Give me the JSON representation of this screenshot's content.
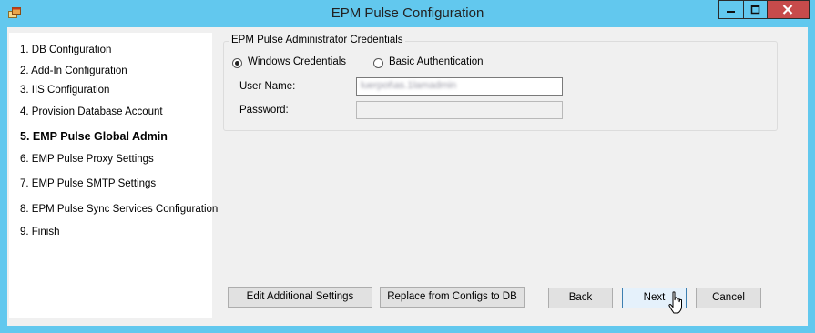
{
  "window": {
    "title": "EPM Pulse Configuration",
    "controls": {
      "minimize": "minimize",
      "maximize": "maximize",
      "close": "close"
    }
  },
  "steps": [
    {
      "label": "1. DB Configuration",
      "current": false
    },
    {
      "label": "2. Add-In Configuration",
      "current": false
    },
    {
      "label": "3. IIS Configuration",
      "current": false
    },
    {
      "label": "4. Provision Database Account",
      "current": false
    },
    {
      "label": "5. EMP Pulse Global Admin",
      "current": true
    },
    {
      "label": "6. EMP Pulse Proxy Settings",
      "current": false
    },
    {
      "label": "7. EMP Pulse SMTP Settings",
      "current": false
    },
    {
      "label": "8. EPM Pulse Sync Services Configuration",
      "current": false
    },
    {
      "label": "9. Finish",
      "current": false
    }
  ],
  "credentials": {
    "group_title": "EPM Pulse Administrator Credentials",
    "auth_options": [
      {
        "label": "Windows Credentials",
        "selected": true
      },
      {
        "label": "Basic Authentication",
        "selected": false
      }
    ],
    "username_label": "User Name:",
    "username_value": "luerpot\\as.1lamadmin",
    "password_label": "Password:",
    "password_value": ""
  },
  "buttons": {
    "edit_settings": "Edit Additional Settings",
    "replace_configs": "Replace from Configs to DB",
    "back": "Back",
    "next": "Next",
    "cancel": "Cancel"
  },
  "colors": {
    "frame": "#62c8ee",
    "close_button": "#c74b4b",
    "client_bg": "#f0f0f0"
  },
  "icons": {
    "app": "app-window-icon",
    "cursor": "hand-pointer-icon"
  }
}
